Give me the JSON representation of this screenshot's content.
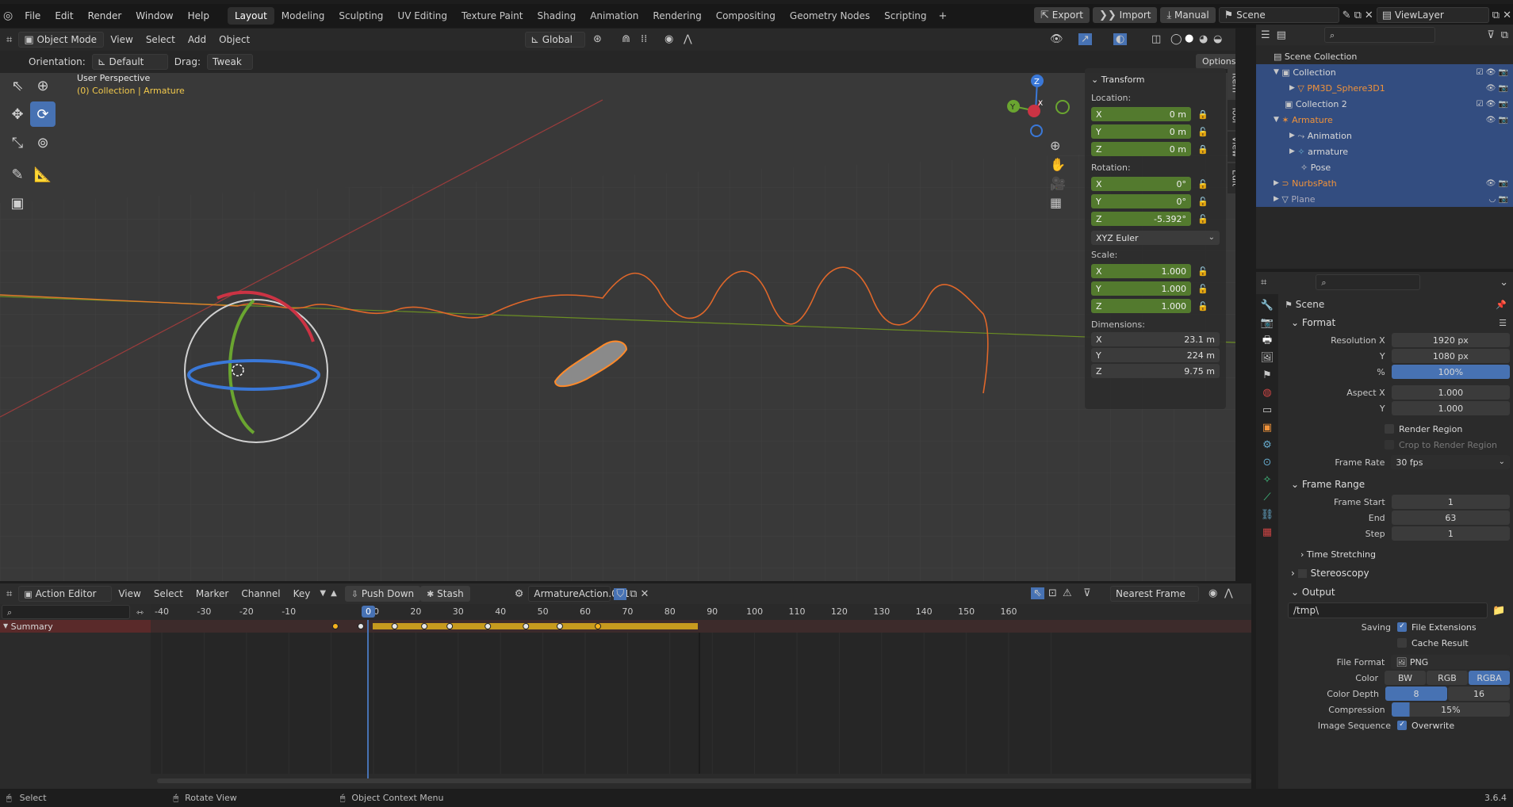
{
  "menu": {
    "items": [
      "File",
      "Edit",
      "Render",
      "Window",
      "Help"
    ]
  },
  "workspaces": [
    "Layout",
    "Modeling",
    "Sculpting",
    "UV Editing",
    "Texture Paint",
    "Shading",
    "Animation",
    "Rendering",
    "Compositing",
    "Geometry Nodes",
    "Scripting"
  ],
  "top_right": {
    "export": "Export",
    "import": "Import",
    "manual": "Manual",
    "scene": "Scene",
    "view_layer": "ViewLayer"
  },
  "viewport": {
    "mode": "Object Mode",
    "view": "View",
    "select": "Select",
    "add": "Add",
    "object": "Object",
    "transform_orientation": "Global",
    "orientation_label": "Orientation:",
    "orientation_value": "Default",
    "drag_label": "Drag:",
    "drag_value": "Tweak",
    "options": "Options",
    "perspective": "User Perspective",
    "context": "(0) Collection | Armature"
  },
  "npanel": {
    "title": "Transform",
    "location_label": "Location:",
    "location": [
      {
        "axis": "X",
        "value": "0 m"
      },
      {
        "axis": "Y",
        "value": "0 m"
      },
      {
        "axis": "Z",
        "value": "0 m"
      }
    ],
    "rotation_label": "Rotation:",
    "rotation": [
      {
        "axis": "X",
        "value": "0°"
      },
      {
        "axis": "Y",
        "value": "0°"
      },
      {
        "axis": "Z",
        "value": "-5.392°"
      }
    ],
    "rotation_mode": "XYZ Euler",
    "scale_label": "Scale:",
    "scale": [
      {
        "axis": "X",
        "value": "1.000"
      },
      {
        "axis": "Y",
        "value": "1.000"
      },
      {
        "axis": "Z",
        "value": "1.000"
      }
    ],
    "dimensions_label": "Dimensions:",
    "dimensions": [
      {
        "axis": "X",
        "value": "23.1 m"
      },
      {
        "axis": "Y",
        "value": "224 m"
      },
      {
        "axis": "Z",
        "value": "9.75 m"
      }
    ],
    "tabs": [
      "Item",
      "Tool",
      "View",
      "Edit"
    ]
  },
  "outliner": {
    "items": [
      {
        "label": "Scene Collection",
        "indent": 0
      },
      {
        "label": "Collection",
        "indent": 1
      },
      {
        "label": "PM3D_Sphere3D1",
        "indent": 2
      },
      {
        "label": "Collection 2",
        "indent": 1
      },
      {
        "label": "Armature",
        "indent": 1
      },
      {
        "label": "Animation",
        "indent": 2
      },
      {
        "label": "armature",
        "indent": 2
      },
      {
        "label": "Pose",
        "indent": 2
      },
      {
        "label": "NurbsPath",
        "indent": 1
      },
      {
        "label": "Plane",
        "indent": 1
      }
    ]
  },
  "properties": {
    "scene": "Scene",
    "format": "Format",
    "resolution_x_label": "Resolution X",
    "resolution_x": "1920 px",
    "y_label": "Y",
    "resolution_y": "1080 px",
    "pct_label": "%",
    "resolution_pct": "100%",
    "aspect_x_label": "Aspect X",
    "aspect_x": "1.000",
    "aspect_y": "1.000",
    "render_region": "Render Region",
    "crop_region": "Crop to Render Region",
    "frame_rate_label": "Frame Rate",
    "frame_rate": "30 fps",
    "frame_range": "Frame Range",
    "frame_start_label": "Frame Start",
    "frame_start": "1",
    "end_label": "End",
    "frame_end": "63",
    "step_label": "Step",
    "frame_step": "1",
    "time_stretching": "Time Stretching",
    "stereoscopy": "Stereoscopy",
    "output": "Output",
    "output_path": "/tmp\\",
    "saving_label": "Saving",
    "file_extensions": "File Extensions",
    "cache_result": "Cache Result",
    "file_format_label": "File Format",
    "file_format": "PNG",
    "color_label": "Color",
    "color_opts": [
      "BW",
      "RGB",
      "RGBA"
    ],
    "color_depth_label": "Color Depth",
    "depth_opts": [
      "8",
      "16"
    ],
    "compression_label": "Compression",
    "compression": "15%",
    "image_sequence_label": "Image Sequence",
    "overwrite": "Overwrite"
  },
  "action_editor": {
    "editor": "Action Editor",
    "view": "View",
    "select": "Select",
    "marker": "Marker",
    "channel": "Channel",
    "key": "Key",
    "push_down": "Push Down",
    "stash": "Stash",
    "action": "ArmatureAction.001",
    "snap": "Nearest Frame",
    "current_frame": "0",
    "ticks": [
      "-40",
      "-30",
      "-20",
      "-10",
      "10",
      "20",
      "30",
      "40",
      "50",
      "60",
      "70",
      "80",
      "90",
      "100",
      "110",
      "120",
      "130",
      "140",
      "150",
      "160"
    ],
    "summary": "Summary"
  },
  "status": {
    "select": "Select",
    "rotate": "Rotate View",
    "context_menu": "Object Context Menu",
    "version": "3.6.4"
  }
}
